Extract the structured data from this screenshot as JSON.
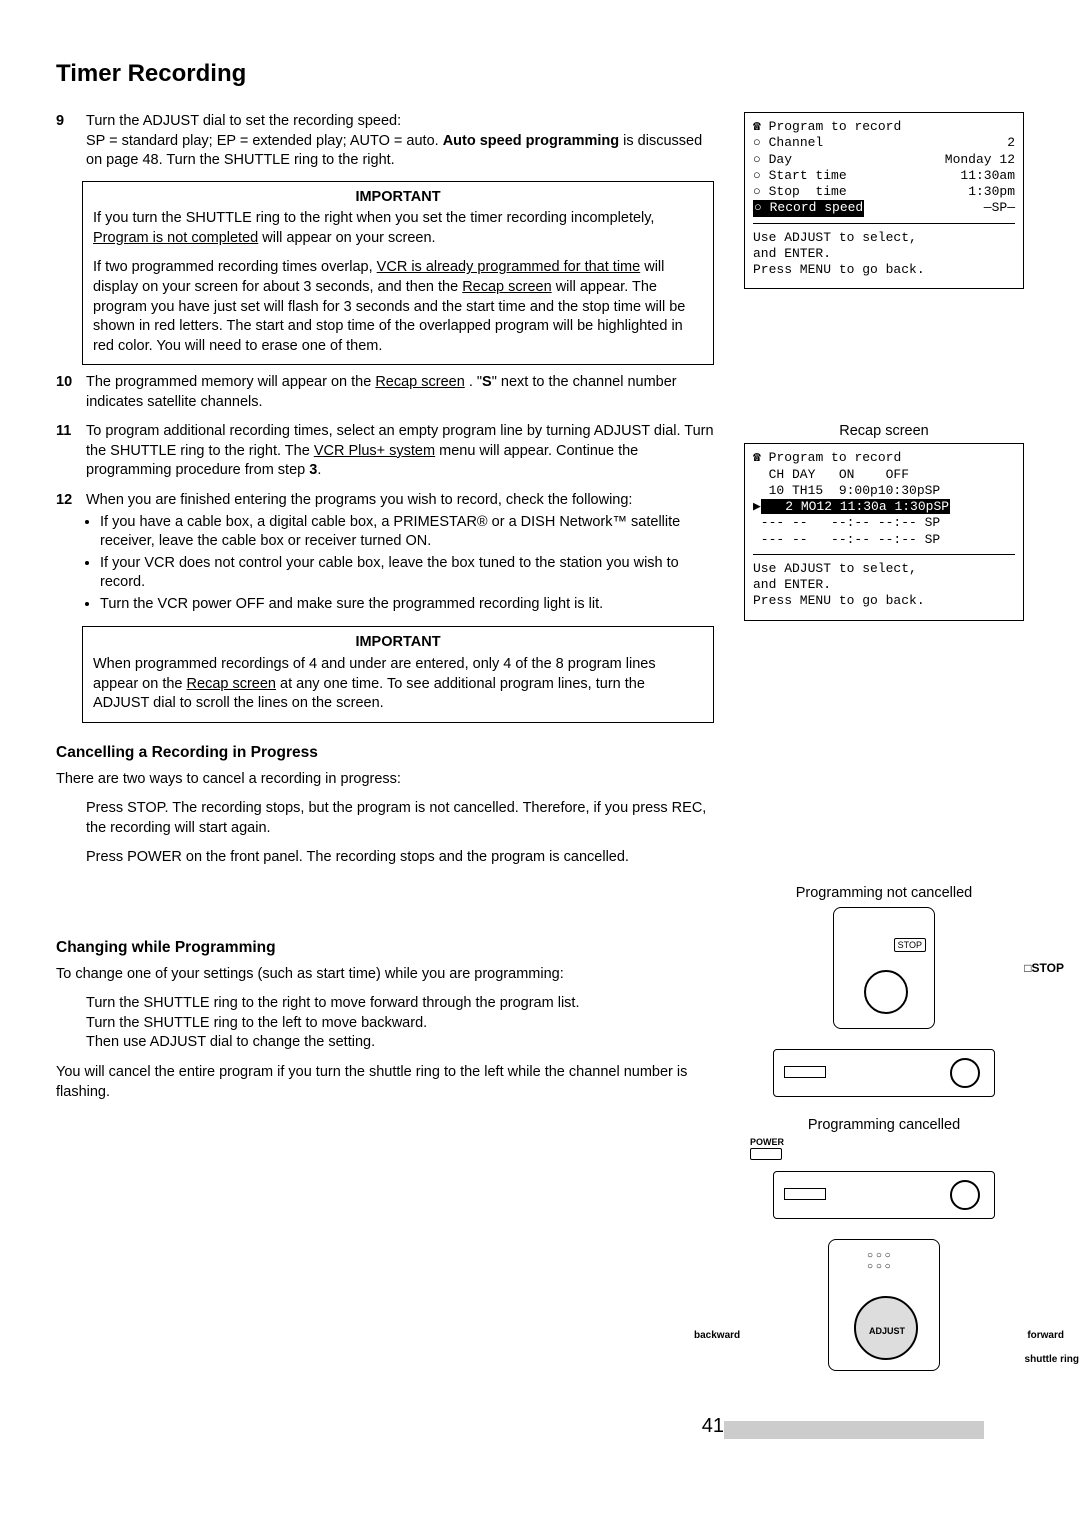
{
  "title": "Timer Recording",
  "page_number": "41",
  "step9": {
    "num": "9",
    "text_a": "Turn the ADJUST dial to set the recording speed:",
    "text_b": "SP = standard play; EP = extended play; AUTO = auto.  ",
    "autospeed": "Auto speed programming",
    "text_c": " is discussed on page 48.  Turn the SHUTTLE ring to the right."
  },
  "important1": {
    "label": "IMPORTANT",
    "p1a": "If you turn the SHUTTLE ring to the right when you set the timer recording incompletely, ",
    "p1u": "Program is not completed",
    "p1b": " will appear on your screen.",
    "p2a": "If two programmed recording times overlap, ",
    "p2u1": "VCR is already programmed for that time",
    "p2b": " will display on your screen for about 3 seconds, and then the ",
    "p2u2": "Recap screen",
    "p2c": " will appear.  The program you have just set will flash for 3 seconds and the start time and the stop time will be shown in red letters.  The start and stop time of the overlapped program will be highlighted in red color.  You will need to erase one of them."
  },
  "step10": {
    "num": "10",
    "a": "The programmed memory will appear on the ",
    "u": "Recap screen",
    "b": ".  \"",
    "bold": "S",
    "c": "\" next to the channel number indicates satellite channels."
  },
  "step11": {
    "num": "11",
    "a": "To program additional recording times, select an empty program line by turning ADJUST dial.  Turn the SHUTTLE ring to the right.  The ",
    "u": "VCR Plus+ system",
    "b": " menu will appear.  Continue the programming procedure from step ",
    "bold": "3",
    "c": "."
  },
  "step12": {
    "num": "12",
    "lead": "When you are finished entering the programs you wish to record, check the following:",
    "li1": "If you have a cable box, a digital cable box, a PRIMESTAR® or a DISH Network™ satellite receiver, leave the cable box or receiver turned ON.",
    "li2": "If your VCR does not control your cable box, leave the box tuned to the station you wish to record.",
    "li3": "Turn the VCR power OFF and make sure the programmed recording light is lit."
  },
  "important2": {
    "label": "IMPORTANT",
    "a": "When programmed recordings of 4 and under are entered, only 4 of the 8 program lines appear on the ",
    "u": "Recap screen",
    "b": " at any one time.  To see additional program lines, turn the ADJUST dial to scroll the lines on the screen."
  },
  "cancel": {
    "heading": "Cancelling a Recording in Progress",
    "intro": "There are two ways to cancel a recording in progress:",
    "p1": "Press STOP.  The recording stops, but the program is not cancelled.  Therefore, if you press REC, the recording will start again.",
    "p2": "Press POWER on the front panel.  The recording stops and the program is cancelled."
  },
  "change": {
    "heading": "Changing while Programming",
    "intro": "To change one of your settings (such as start time) while you are programming:",
    "l1": "Turn the SHUTTLE ring to the right to move forward through the program list.",
    "l2": "Turn the SHUTTLE ring to the left to move backward.",
    "l3": "Then use ADJUST dial to change the setting.",
    "outro": "You will cancel the entire program if you turn the shuttle ring to the left while the channel number is flashing."
  },
  "osd1": {
    "title": "Program to record",
    "row_channel_l": "Channel",
    "row_channel_v": "2",
    "row_day_l": "Day",
    "row_day_v": "Monday 12",
    "row_start_l": "Start time",
    "row_start_v": "11:30am",
    "row_stop_l": "Stop  time",
    "row_stop_v": "1:30pm",
    "row_speed_l": "Record speed",
    "row_speed_v": "SP",
    "help1": "Use ADJUST to select,",
    "help2": "and ENTER.",
    "help3": "Press MENU to go back."
  },
  "recap_caption": "Recap screen",
  "osd2": {
    "title": "Program to record",
    "hdr": "  CH DAY   ON    OFF",
    "row1": "  10 TH15  9:00p10:30pSP",
    "row2_hl": "   2 MO12 11:30a 1:30pSP",
    "row3": " --- --   --:-- --:-- SP",
    "row4": " --- --   --:-- --:-- SP",
    "help1": "Use ADJUST to select,",
    "help2": "and ENTER.",
    "help3": "Press MENU to go back."
  },
  "fig_not_cancelled": "Programming not cancelled",
  "fig_stop_btn": "STOP",
  "fig_stop_label": "□STOP",
  "fig_cancelled": "Programming cancelled",
  "fig_power": "POWER",
  "fig_backward": "backward",
  "fig_forward": "forward",
  "fig_adjust": "ADJUST",
  "fig_shuttle": "shuttle ring"
}
